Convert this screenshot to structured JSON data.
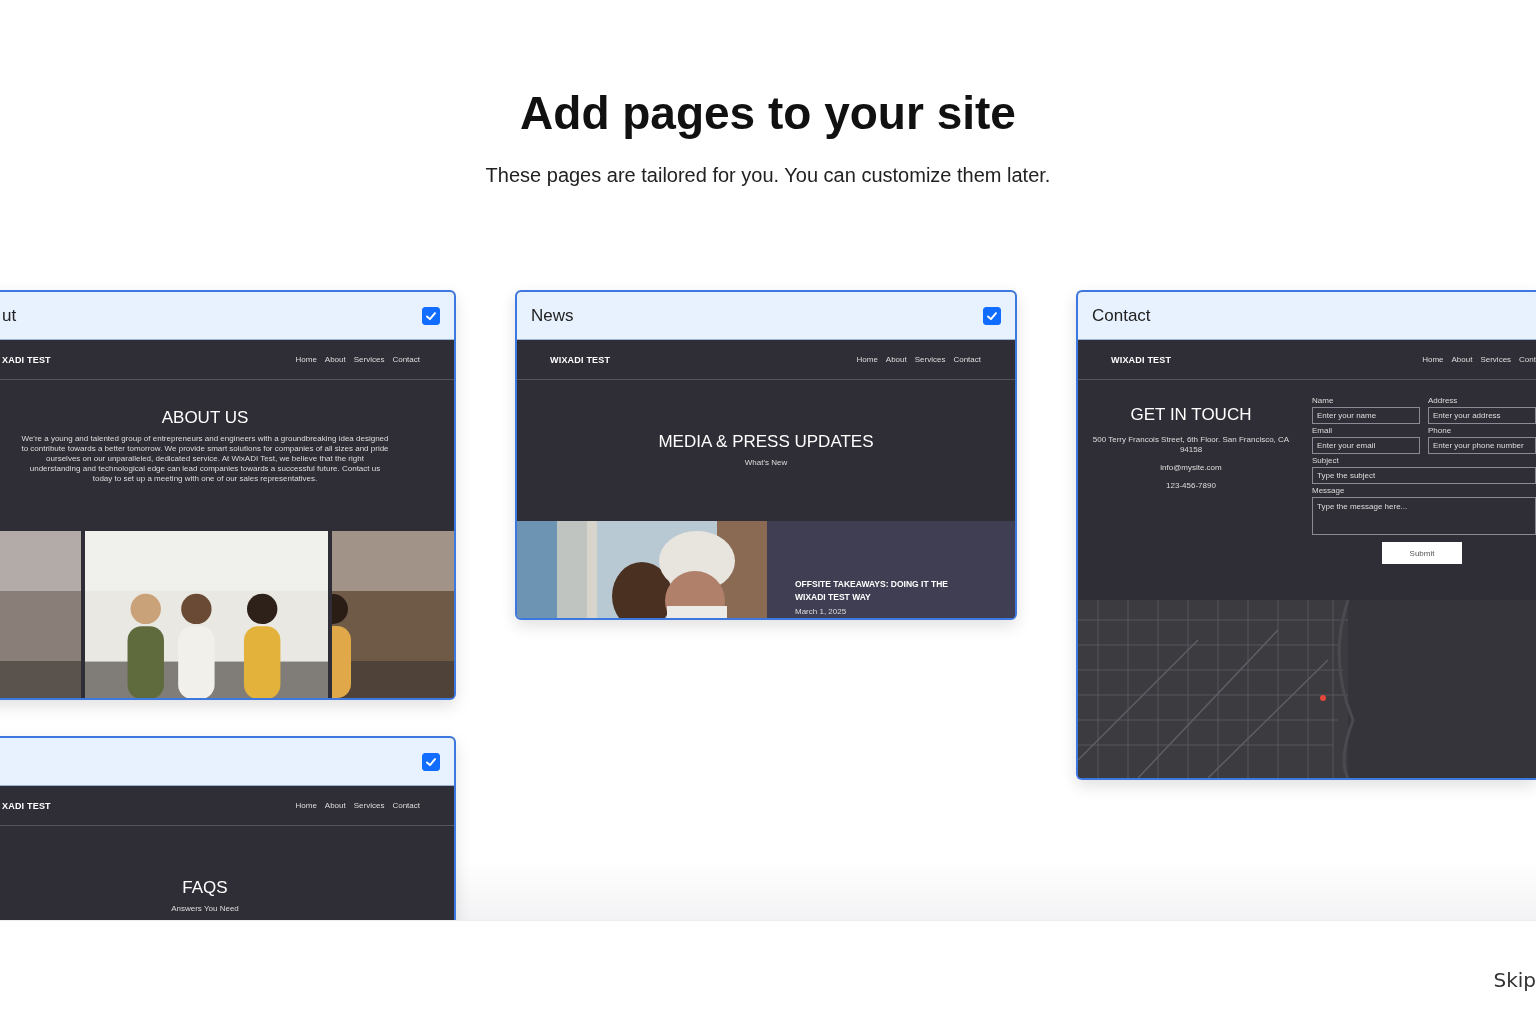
{
  "heading": "Add pages to your site",
  "subheading": "These pages are tailored for you. You can customize them later.",
  "columns": [
    {
      "cards": [
        {
          "kind": "about",
          "title": "ut",
          "selected": true,
          "site": {
            "logo": "XADI TEST",
            "nav": [
              "Home",
              "About",
              "Services",
              "Contact"
            ]
          },
          "hero_title": "ABOUT US",
          "hero_text": "We're a young and talented group of entrepreneurs and engineers with a groundbreaking idea designed to contribute towards a better tomorrow. We provide smart solutions for companies of all sizes and pride ourselves on our unparalleled, dedicated service. At WixADI Test, we believe that the right understanding and technological edge can lead companies towards a successful future. Contact us today to set up a meeting with one of our sales representatives."
        },
        {
          "kind": "faq",
          "selected": true,
          "site": {
            "logo": "XADI TEST",
            "nav": [
              "Home",
              "About",
              "Services",
              "Contact"
            ]
          },
          "hero_title": "FAQS",
          "hero_subtitle": "Answers You Need"
        }
      ]
    },
    {
      "cards": [
        {
          "kind": "news",
          "title": "News",
          "selected": true,
          "site": {
            "logo": "WIXADI TEST",
            "nav": [
              "Home",
              "About",
              "Services",
              "Contact"
            ]
          },
          "hero_title": "MEDIA & PRESS UPDATES",
          "hero_subtitle": "What's New",
          "post_title": "OFFSITE TAKEAWAYS: DOING IT THE WIXADI TEST WAY",
          "post_date": "March 1, 2025"
        }
      ]
    },
    {
      "cards": [
        {
          "kind": "contact",
          "title": "Contact",
          "site": {
            "logo": "WIXADI TEST",
            "nav": [
              "Home",
              "About",
              "Services",
              "Cont"
            ]
          },
          "hero_title": "GET IN TOUCH",
          "address": "500 Terry Francois Street, 6th Floor. San Francisco, CA 94158",
          "email": "info@mysite.com",
          "phone": "123-456-7890",
          "fields": [
            {
              "kind": "half",
              "label": "Name",
              "placeholder": "Enter your name"
            },
            {
              "kind": "half",
              "label": "Address",
              "placeholder": "Enter your address"
            },
            {
              "kind": "half",
              "label": "Email",
              "placeholder": "Enter your email"
            },
            {
              "kind": "half",
              "label": "Phone",
              "placeholder": "Enter your phone number"
            },
            {
              "kind": "wide",
              "label": "Subject",
              "placeholder": "Type the subject"
            },
            {
              "kind": "area",
              "label": "Message",
              "placeholder": "Type the message here..."
            }
          ],
          "submit": "Submit"
        }
      ]
    }
  ],
  "skip": "Skip"
}
